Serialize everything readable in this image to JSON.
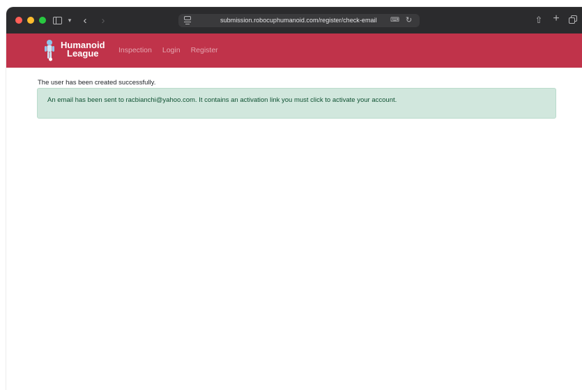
{
  "browser": {
    "url": "submission.robocuphumanoid.com/register/check-email"
  },
  "navbar": {
    "brand_line1": "Humanoid",
    "brand_line2": "League",
    "links": [
      {
        "label": "Inspection"
      },
      {
        "label": "Login"
      },
      {
        "label": "Register"
      }
    ],
    "color": "#c0334a"
  },
  "main": {
    "message": "The user has been created successfully.",
    "alert_text": "An email has been sent to racbianchi@yahoo.com. It contains an activation link you must click to activate your account.",
    "alert_color": "#d1e7dd"
  }
}
